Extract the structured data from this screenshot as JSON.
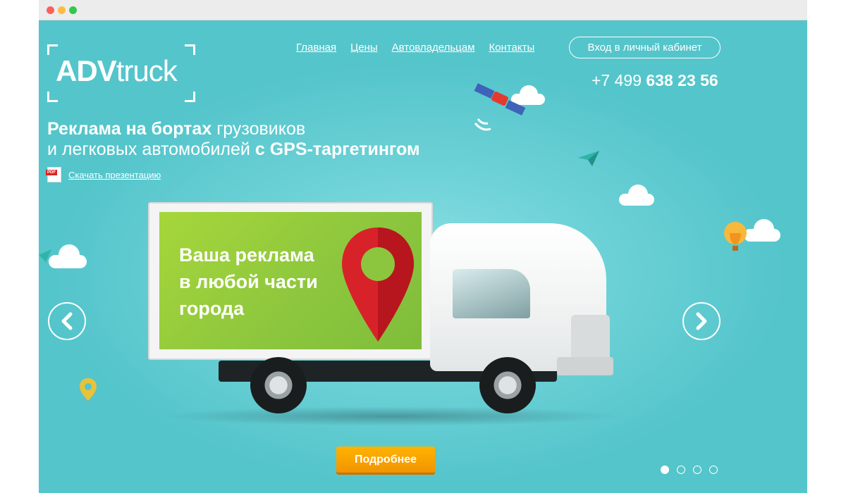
{
  "window": {
    "controls": [
      "close",
      "minimize",
      "maximize"
    ]
  },
  "logo": {
    "bold": "ADV",
    "light": "truck"
  },
  "nav": {
    "items": [
      "Главная",
      "Цены",
      "Автовладельцам",
      "Контакты"
    ],
    "login_label": "Вход в личный кабинет"
  },
  "phone": {
    "prefix": "+7 499",
    "number": "638 23 56"
  },
  "headline": {
    "line1_bold": "Реклама на бортах",
    "line1_regular": "грузовиков",
    "line2_regular": "и легковых автомобилей",
    "line2_bold": "с GPS-таргетингом"
  },
  "download": {
    "icon_label": "PDF",
    "label": "Скачать презентацию"
  },
  "banner": {
    "ad_lines": [
      "Ваша реклама",
      "в любой части",
      "города"
    ]
  },
  "slider": {
    "prev_icon": "chevron-left-icon",
    "next_icon": "chevron-right-icon",
    "more_label": "Подробнее",
    "page_count": 4,
    "active_page": 1
  },
  "colors": {
    "background": "#54c5cb",
    "accent_button": "#f29400",
    "banner_green": "#8cc63e",
    "pin_red": "#d8222a"
  }
}
